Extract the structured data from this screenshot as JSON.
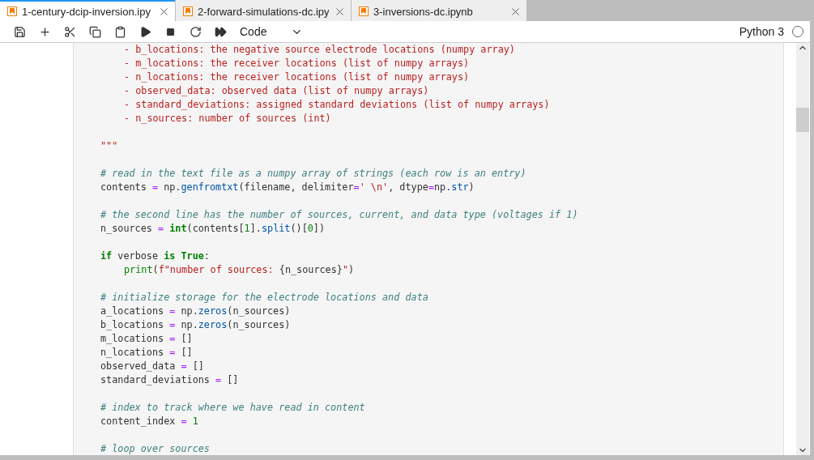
{
  "tabs": [
    {
      "label": "1-century-dcip-inversion.ipy",
      "selected": true
    },
    {
      "label": "2-forward-simulations-dc.ipy",
      "selected": false
    },
    {
      "label": "3-inversions-dc.ipynb",
      "selected": false
    }
  ],
  "toolbar": {
    "buttons": [
      {
        "kind": "save"
      },
      {
        "kind": "insert"
      },
      {
        "kind": "cut"
      },
      {
        "kind": "copy"
      },
      {
        "kind": "paste"
      },
      {
        "kind": "run"
      },
      {
        "kind": "stop"
      },
      {
        "kind": "restart"
      },
      {
        "kind": "run-all"
      }
    ],
    "cell_type": "Code",
    "kernel": "Python 3"
  },
  "code": [
    {
      "kind": "indented",
      "tokens": [
        {
          "kind": "str",
          "text": "- b_locations: the negative source electrode locations (numpy array)"
        }
      ]
    },
    {
      "kind": "indented",
      "tokens": [
        {
          "kind": "str",
          "text": "- m_locations: the receiver locations (list of numpy arrays)"
        }
      ]
    },
    {
      "kind": "indented",
      "tokens": [
        {
          "kind": "str",
          "text": "- n_locations: the receiver locations (list of numpy arrays)"
        }
      ]
    },
    {
      "kind": "indented",
      "tokens": [
        {
          "kind": "str",
          "text": "- observed_data: observed data (list of numpy arrays)"
        }
      ]
    },
    {
      "kind": "indented",
      "tokens": [
        {
          "kind": "str",
          "text": "- standard_deviations: assigned standard deviations (list of numpy arrays)"
        }
      ]
    },
    {
      "kind": "indented",
      "tokens": [
        {
          "kind": "str",
          "text": "- n_sources: number of sources (int)"
        }
      ]
    },
    {
      "kind": "blank"
    },
    {
      "kind": "top",
      "tokens": [
        {
          "kind": "str",
          "text": "\"\"\""
        }
      ]
    },
    {
      "kind": "blank"
    },
    {
      "kind": "top",
      "tokens": [
        {
          "kind": "comment",
          "text": "# read in the text file as a numpy array of strings (each row is an entry)"
        }
      ]
    },
    {
      "kind": "top",
      "tokens": [
        {
          "kind": "plain",
          "text": "contents "
        },
        {
          "kind": "op",
          "text": "="
        },
        {
          "kind": "plain",
          "text": " np."
        },
        {
          "kind": "call",
          "text": "genfromtxt"
        },
        {
          "kind": "plain",
          "text": "(filename, delimiter"
        },
        {
          "kind": "op",
          "text": "="
        },
        {
          "kind": "str",
          "text": "' \\n'"
        },
        {
          "kind": "plain",
          "text": ", dtype"
        },
        {
          "kind": "op",
          "text": "="
        },
        {
          "kind": "plain",
          "text": "np."
        },
        {
          "kind": "call",
          "text": "str"
        },
        {
          "kind": "plain",
          "text": ")"
        }
      ]
    },
    {
      "kind": "blank"
    },
    {
      "kind": "top",
      "tokens": [
        {
          "kind": "comment",
          "text": "# the second line has the number of sources, current, and data type (voltages if 1)"
        }
      ]
    },
    {
      "kind": "top",
      "tokens": [
        {
          "kind": "plain",
          "text": "n_sources "
        },
        {
          "kind": "op",
          "text": "= "
        },
        {
          "kind": "kw",
          "text": "int"
        },
        {
          "kind": "plain",
          "text": "(contents["
        },
        {
          "kind": "num",
          "text": "1"
        },
        {
          "kind": "plain",
          "text": "]."
        },
        {
          "kind": "call",
          "text": "split"
        },
        {
          "kind": "plain",
          "text": "()["
        },
        {
          "kind": "num",
          "text": "0"
        },
        {
          "kind": "plain",
          "text": "])"
        }
      ]
    },
    {
      "kind": "blank"
    },
    {
      "kind": "top",
      "tokens": [
        {
          "kind": "kw",
          "text": "if"
        },
        {
          "kind": "plain",
          "text": " verbose "
        },
        {
          "kind": "kw",
          "text": "is True"
        },
        {
          "kind": "plain",
          "text": ":"
        }
      ]
    },
    {
      "kind": "indented",
      "tokens": [
        {
          "kind": "builtin",
          "text": "print"
        },
        {
          "kind": "plain",
          "text": "("
        },
        {
          "kind": "str",
          "text": "f\"number of sources: "
        },
        {
          "kind": "plain",
          "text": "{n_sources}"
        },
        {
          "kind": "str",
          "text": "\""
        },
        {
          "kind": "plain",
          "text": ")"
        }
      ]
    },
    {
      "kind": "blank"
    },
    {
      "kind": "top",
      "tokens": [
        {
          "kind": "comment",
          "text": "# initialize storage for the electrode locations and data"
        }
      ]
    },
    {
      "kind": "top",
      "tokens": [
        {
          "kind": "plain",
          "text": "a_locations "
        },
        {
          "kind": "op",
          "text": "="
        },
        {
          "kind": "plain",
          "text": " np."
        },
        {
          "kind": "call",
          "text": "zeros"
        },
        {
          "kind": "plain",
          "text": "(n_sources)"
        }
      ]
    },
    {
      "kind": "top",
      "tokens": [
        {
          "kind": "plain",
          "text": "b_locations "
        },
        {
          "kind": "op",
          "text": "="
        },
        {
          "kind": "plain",
          "text": " np."
        },
        {
          "kind": "call",
          "text": "zeros"
        },
        {
          "kind": "plain",
          "text": "(n_sources)"
        }
      ]
    },
    {
      "kind": "top",
      "tokens": [
        {
          "kind": "plain",
          "text": "m_locations "
        },
        {
          "kind": "op",
          "text": "="
        },
        {
          "kind": "plain",
          "text": " []"
        }
      ]
    },
    {
      "kind": "top",
      "tokens": [
        {
          "kind": "plain",
          "text": "n_locations "
        },
        {
          "kind": "op",
          "text": "="
        },
        {
          "kind": "plain",
          "text": " []"
        }
      ]
    },
    {
      "kind": "top",
      "tokens": [
        {
          "kind": "plain",
          "text": "observed_data "
        },
        {
          "kind": "op",
          "text": "="
        },
        {
          "kind": "plain",
          "text": " []"
        }
      ]
    },
    {
      "kind": "top",
      "tokens": [
        {
          "kind": "plain",
          "text": "standard_deviations "
        },
        {
          "kind": "op",
          "text": "="
        },
        {
          "kind": "plain",
          "text": " []"
        }
      ]
    },
    {
      "kind": "blank"
    },
    {
      "kind": "top",
      "tokens": [
        {
          "kind": "comment",
          "text": "# index to track where we have read in content"
        }
      ]
    },
    {
      "kind": "top",
      "tokens": [
        {
          "kind": "plain",
          "text": "content_index "
        },
        {
          "kind": "op",
          "text": "= "
        },
        {
          "kind": "num",
          "text": "1"
        }
      ]
    },
    {
      "kind": "blank"
    },
    {
      "kind": "top",
      "tokens": [
        {
          "kind": "comment",
          "text": "# loop over sources"
        }
      ]
    }
  ]
}
